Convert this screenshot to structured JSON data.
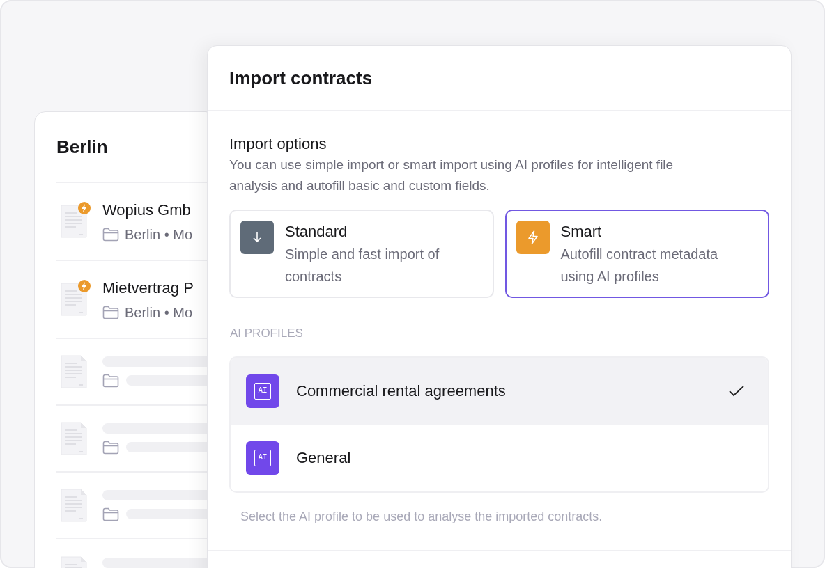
{
  "back_card": {
    "title": "Berlin",
    "rows": [
      {
        "kind": "contract",
        "name": "Wopius Gmb",
        "location": "Berlin • Mo",
        "smart": true
      },
      {
        "kind": "contract",
        "name": "Mietvertrag P",
        "location": "Berlin • Mo",
        "smart": true
      },
      {
        "kind": "loading"
      },
      {
        "kind": "loading"
      },
      {
        "kind": "loading"
      },
      {
        "kind": "loading_cut"
      }
    ]
  },
  "dialog": {
    "title": "Import contracts",
    "section_title": "Import options",
    "description": "You can use simple import or smart import using AI profiles for intelligent file analysis and autofill basic and custom fields.",
    "options": [
      {
        "kind": "standard",
        "title": "Standard",
        "description": "Simple and fast import of contracts",
        "selected": false
      },
      {
        "kind": "smart",
        "title": "Smart",
        "description": "Autofill contract metadata using AI profiles",
        "selected": true
      }
    ],
    "profiles_label": "AI PROFILES",
    "profiles": [
      {
        "icon_text": "AI",
        "name": "Commercial rental agreements",
        "selected": true
      },
      {
        "icon_text": "AI",
        "name": "General",
        "selected": false
      }
    ],
    "hint": "Select the AI profile to be used to analyse the imported contracts."
  }
}
